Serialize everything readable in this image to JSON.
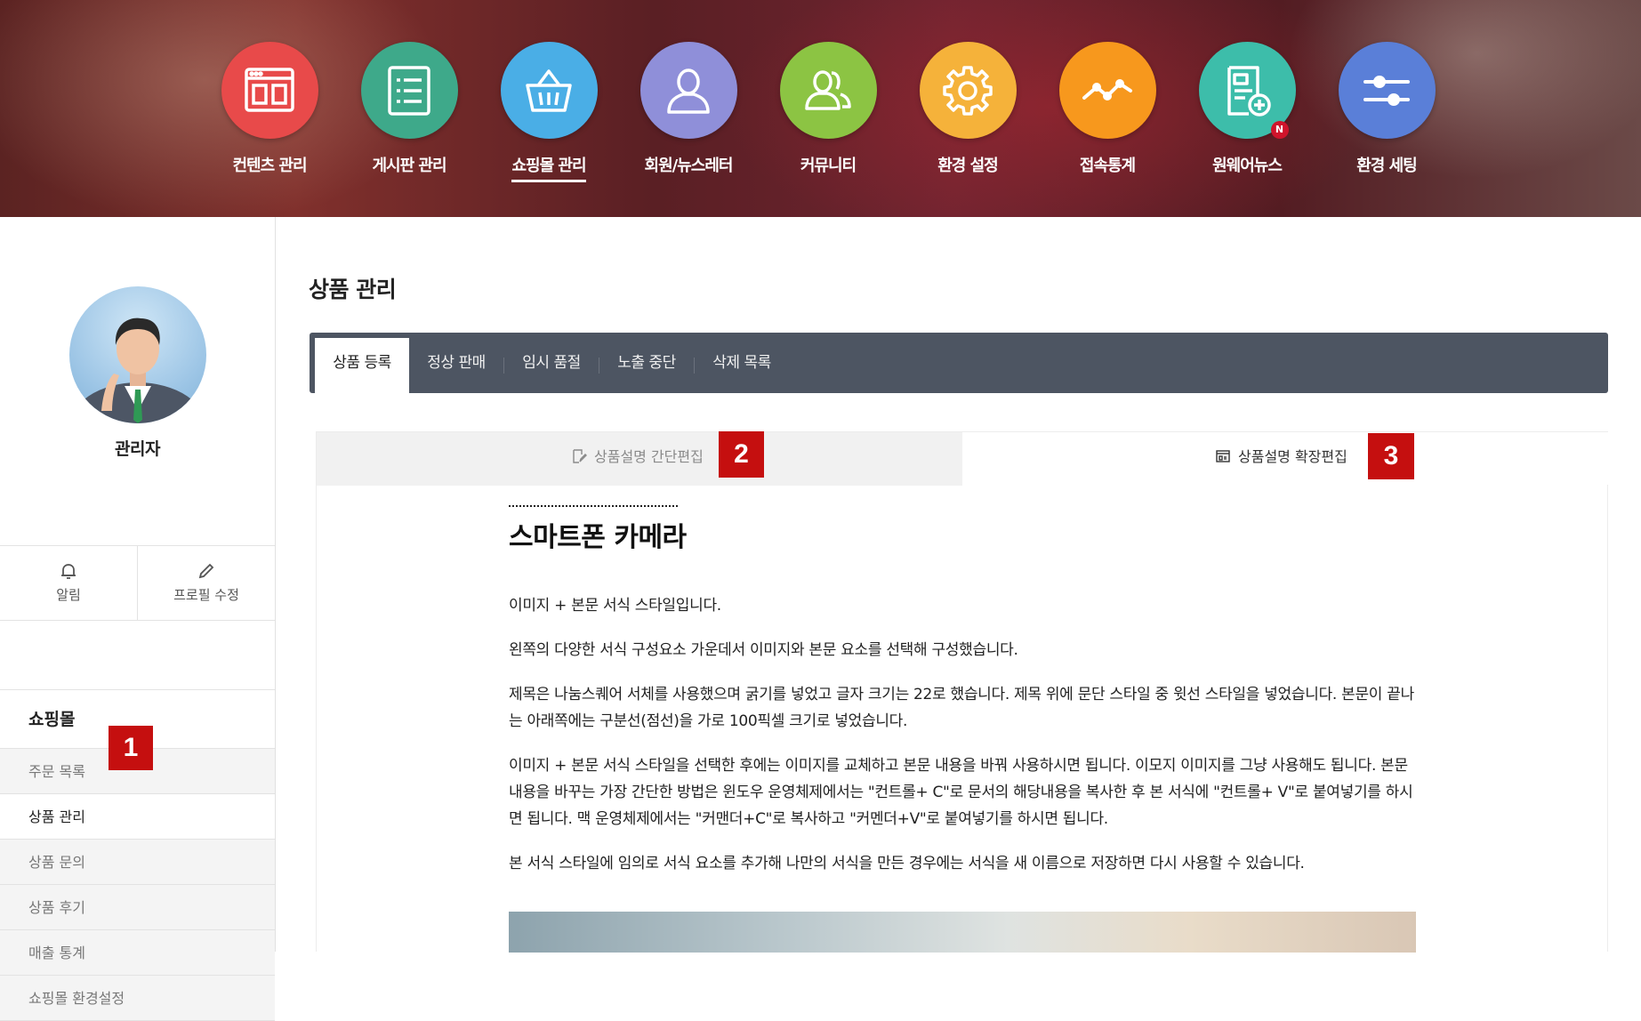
{
  "nav": {
    "items": [
      {
        "label": "컨텐츠 관리",
        "icon": "content-window-icon",
        "color": "#e84a4a"
      },
      {
        "label": "게시판 관리",
        "icon": "board-list-icon",
        "color": "#3ea98a"
      },
      {
        "label": "쇼핑몰 관리",
        "icon": "shopping-basket-icon",
        "color": "#4aaee6",
        "active": true
      },
      {
        "label": "회원/뉴스레터",
        "icon": "member-user-icon",
        "color": "#8f8fd9"
      },
      {
        "label": "커뮤니티",
        "icon": "community-users-icon",
        "color": "#8cc443"
      },
      {
        "label": "환경 설정",
        "icon": "gear-icon",
        "color": "#f5b23a"
      },
      {
        "label": "접속통계",
        "icon": "statistics-line-icon",
        "color": "#f7981d"
      },
      {
        "label": "원웨어뉴스",
        "icon": "news-document-icon",
        "color": "#3dbdaa",
        "badge": "N"
      },
      {
        "label": "환경 세팅",
        "icon": "sliders-icon",
        "color": "#5a7fd8"
      }
    ]
  },
  "profile": {
    "name": "관리자",
    "alert_label": "알림",
    "edit_label": "프로필 수정"
  },
  "sidebar": {
    "section_title": "쇼핑몰",
    "items": [
      {
        "label": "주문 목록"
      },
      {
        "label": "상품 관리",
        "active": true
      },
      {
        "label": "상품 문의"
      },
      {
        "label": "상품 후기"
      },
      {
        "label": "매출 통계"
      },
      {
        "label": "쇼핑몰 환경설정"
      }
    ]
  },
  "main": {
    "title": "상품 관리",
    "tabs": [
      {
        "label": "상품 등록",
        "active": true
      },
      {
        "label": "정상 판매"
      },
      {
        "label": "임시 품절"
      },
      {
        "label": "노출 중단"
      },
      {
        "label": "삭제 목록"
      }
    ],
    "editor_tabs": {
      "simple_label": "상품설명 간단편집",
      "extended_label": "상품설명 확장편집"
    }
  },
  "markers": [
    "1",
    "2",
    "3"
  ],
  "document": {
    "title": "스마트폰 카메라",
    "paragraphs": [
      "이미지 + 본문 서식 스타일입니다.",
      "왼쪽의 다양한 서식 구성요소 가운데서 이미지와 본문 요소를 선택해 구성했습니다.",
      "제목은 나눔스퀘어 서체를 사용했으며 굵기를 넣었고 글자 크기는 22로 했습니다. 제목 위에 문단 스타일 중 윗선 스타일을 넣었습니다. 본문이 끝나는 아래쪽에는 구분선(점선)을 가로 100픽셀 크기로 넣었습니다.",
      "이미지 + 본문 서식 스타일을 선택한 후에는 이미지를 교체하고 본문 내용을 바꿔 사용하시면 됩니다. 이모지 이미지를 그냥 사용해도 됩니다. 본문 내용을 바꾸는 가장 간단한 방법은 윈도우 운영체제에서는 \"컨트롤+ C\"로 문서의 해당내용을 복사한 후 본 서식에 \"컨트롤+ V\"로 붙여넣기를 하시면 됩니다. 맥 운영체제에서는 \"커맨더+C\"로 복사하고 \"커멘더+V\"로 붙여넣기를 하시면 됩니다.",
      "본 서식 스타일에 임의로 서식 요소를 추가해 나만의 서식을 만든 경우에는 서식을 새 이름으로 저장하면 다시 사용할 수 있습니다."
    ]
  }
}
